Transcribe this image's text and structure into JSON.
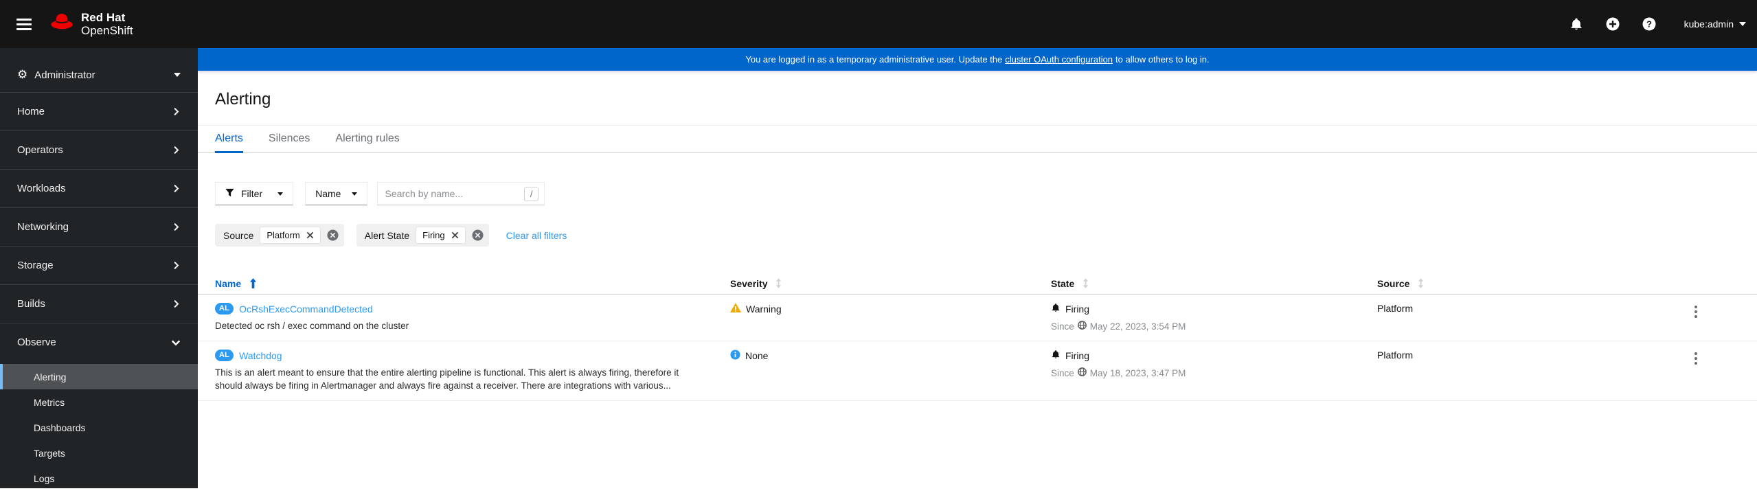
{
  "masthead": {
    "brand_line1": "Red Hat",
    "brand_line2": "OpenShift",
    "username": "kube:admin"
  },
  "banner": {
    "text_before": "You are logged in as a temporary administrative user. Update the ",
    "link_text": "cluster OAuth configuration",
    "text_after": " to allow others to log in."
  },
  "sidebar": {
    "perspective": "Administrator",
    "items": [
      {
        "label": "Home"
      },
      {
        "label": "Operators"
      },
      {
        "label": "Workloads"
      },
      {
        "label": "Networking"
      },
      {
        "label": "Storage"
      },
      {
        "label": "Builds"
      },
      {
        "label": "Observe"
      }
    ],
    "observe_children": [
      {
        "label": "Alerting",
        "active": true
      },
      {
        "label": "Metrics"
      },
      {
        "label": "Dashboards"
      },
      {
        "label": "Targets"
      },
      {
        "label": "Logs"
      }
    ]
  },
  "page": {
    "title": "Alerting"
  },
  "tabs": [
    {
      "label": "Alerts",
      "active": true
    },
    {
      "label": "Silences"
    },
    {
      "label": "Alerting rules"
    }
  ],
  "toolbar": {
    "filter_label": "Filter",
    "name_label": "Name",
    "search_placeholder": "Search by name...",
    "shortcut_hint": "/"
  },
  "filters": {
    "groups": [
      {
        "category": "Source",
        "chip": "Platform"
      },
      {
        "category": "Alert State",
        "chip": "Firing"
      }
    ],
    "clear_all_label": "Clear all filters"
  },
  "table": {
    "columns": [
      "Name",
      "Severity",
      "State",
      "Source"
    ],
    "since_label": "Since",
    "rows": [
      {
        "badge": "AL",
        "name": "OcRshExecCommandDetected",
        "description": "Detected oc rsh / exec command on the cluster",
        "severity": "Warning",
        "state": "Firing",
        "since": "May 22, 2023, 3:54 PM",
        "source": "Platform"
      },
      {
        "badge": "AL",
        "name": "Watchdog",
        "description": "This is an alert meant to ensure that the entire alerting pipeline is functional. This alert is always firing, therefore it should always be firing in Alertmanager and always fire against a receiver. There are integrations with various...",
        "severity": "None",
        "state": "Firing",
        "since": "May 18, 2023, 3:47 PM",
        "source": "Platform"
      }
    ]
  },
  "icons": {
    "gears": "⚙"
  },
  "colors": {
    "masthead_bg": "#151515",
    "sidebar_bg": "#212427",
    "banner_blue": "#0066cc",
    "accent_blue": "#0066cc",
    "link_blue": "#2b9af3",
    "badge_blue": "#2b9af3",
    "warning_orange": "#f0ab00",
    "info_blue": "#2b9af3",
    "nav_active_bg": "#4f5255",
    "nav_active_accent": "#73bcf7"
  }
}
